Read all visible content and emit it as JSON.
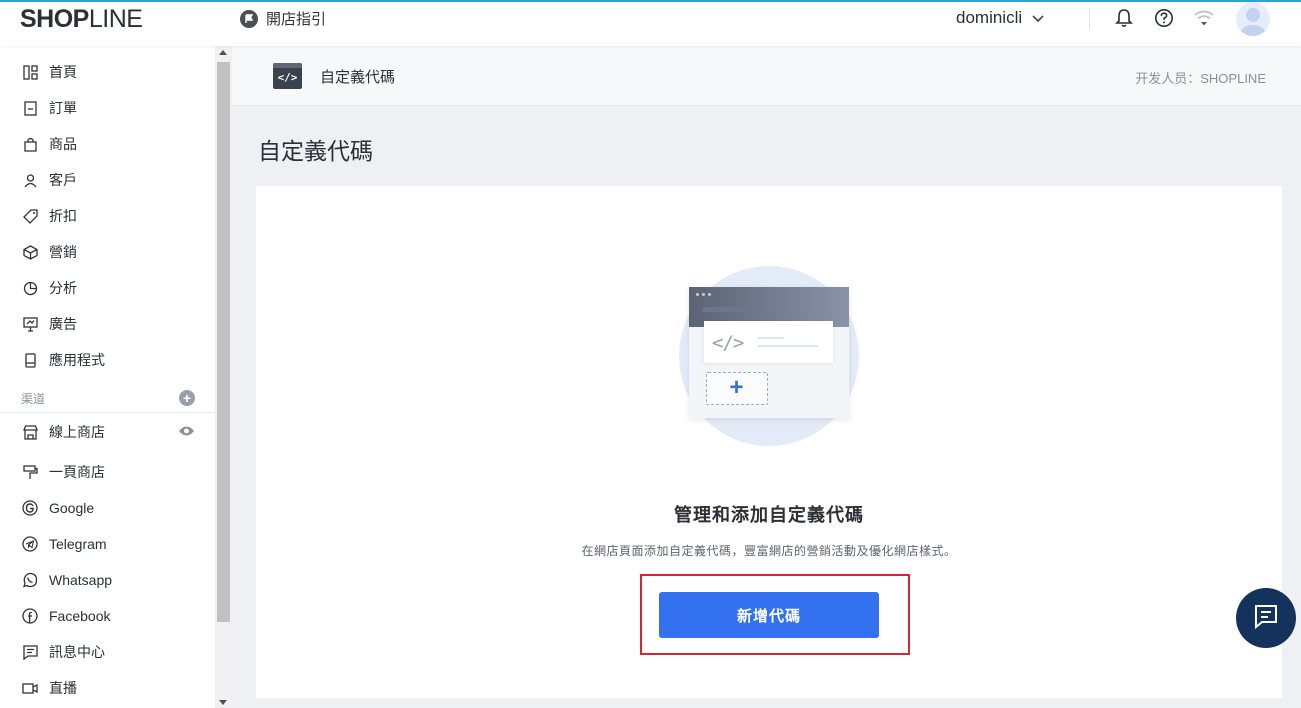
{
  "topbar": {
    "logo_bold": "SHOP",
    "logo_thin": "LINE",
    "guide_label": "開店指引",
    "username": "dominicli"
  },
  "sidebar": {
    "items": [
      {
        "label": "首頁",
        "icon": "home-icon"
      },
      {
        "label": "訂單",
        "icon": "order-icon"
      },
      {
        "label": "商品",
        "icon": "bag-icon"
      },
      {
        "label": "客戶",
        "icon": "person-icon"
      },
      {
        "label": "折扣",
        "icon": "tag-icon"
      },
      {
        "label": "營銷",
        "icon": "cube-icon"
      },
      {
        "label": "分析",
        "icon": "pie-icon"
      },
      {
        "label": "廣告",
        "icon": "monitor-icon"
      },
      {
        "label": "應用程式",
        "icon": "app-icon"
      }
    ],
    "channels_label": "渠道",
    "channels": [
      {
        "label": "線上商店",
        "icon": "store-icon"
      },
      {
        "label": "一頁商店",
        "icon": "paint-roller-icon"
      },
      {
        "label": "Google",
        "icon": "google-icon"
      },
      {
        "label": "Telegram",
        "icon": "telegram-icon"
      },
      {
        "label": "Whatsapp",
        "icon": "whatsapp-icon"
      },
      {
        "label": "Facebook",
        "icon": "facebook-icon"
      },
      {
        "label": "訊息中心",
        "icon": "message-icon"
      },
      {
        "label": "直播",
        "icon": "video-icon"
      }
    ]
  },
  "pagebar": {
    "code_badge": "</>",
    "title": "自定義代碼",
    "developer": "开发人员：SHOPLINE"
  },
  "main": {
    "page_title": "自定義代碼",
    "illustration_code": "</>",
    "empty_title": "管理和添加自定義代碼",
    "empty_desc": "在網店頁面添加自定義代碼，豐富網店的營銷活動及優化網店樣式。",
    "add_button": "新增代碼"
  },
  "colors": {
    "primary": "#3371f0",
    "highlight": "#d22630",
    "chat_fab": "#13325c"
  }
}
